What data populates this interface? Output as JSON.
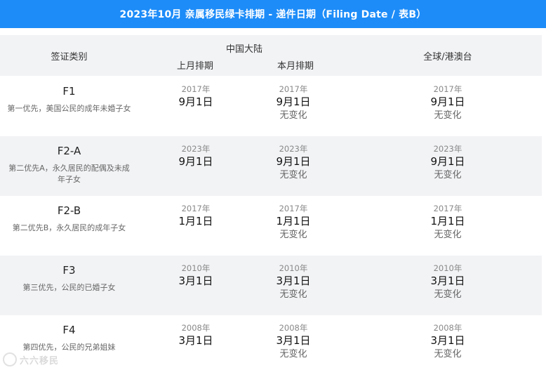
{
  "title": "2023年10月 亲属移民绿卡排期 - 递件日期（Filing Date / 表B）",
  "header": {
    "category": "签证类别",
    "mainland": "中国大陆",
    "last_month": "上月排期",
    "this_month": "本月排期",
    "global": "全球/港澳台"
  },
  "rows": [
    {
      "code": "F1",
      "desc": "第一优先，美国公民的成年未婚子女",
      "last": {
        "year": "2017年",
        "day": "9月1日"
      },
      "this": {
        "year": "2017年",
        "day": "9月1日",
        "change": "无变化"
      },
      "global": {
        "year": "2017年",
        "day": "9月1日",
        "change": "无变化"
      }
    },
    {
      "code": "F2-A",
      "desc": "第二优先A，永久居民的配偶及未成年子女",
      "last": {
        "year": "2023年",
        "day": "9月1日"
      },
      "this": {
        "year": "2023年",
        "day": "9月1日",
        "change": "无变化"
      },
      "global": {
        "year": "2023年",
        "day": "9月1日",
        "change": "无变化"
      }
    },
    {
      "code": "F2-B",
      "desc": "第二优先B，永久居民的成年子女",
      "last": {
        "year": "2017年",
        "day": "1月1日"
      },
      "this": {
        "year": "2017年",
        "day": "1月1日",
        "change": "无变化"
      },
      "global": {
        "year": "2017年",
        "day": "1月1日",
        "change": "无变化"
      }
    },
    {
      "code": "F3",
      "desc": "第三优先，公民的已婚子女",
      "last": {
        "year": "2010年",
        "day": "3月1日"
      },
      "this": {
        "year": "2010年",
        "day": "3月1日",
        "change": "无变化"
      },
      "global": {
        "year": "2010年",
        "day": "3月1日",
        "change": "无变化"
      }
    },
    {
      "code": "F4",
      "desc": "第四优先，公民的兄弟姐妹",
      "last": {
        "year": "2008年",
        "day": "3月1日"
      },
      "this": {
        "year": "2008年",
        "day": "3月1日",
        "change": "无变化"
      },
      "global": {
        "year": "2008年",
        "day": "3月1日",
        "change": "无变化"
      }
    }
  ],
  "watermark": {
    "text": "六六移民"
  }
}
